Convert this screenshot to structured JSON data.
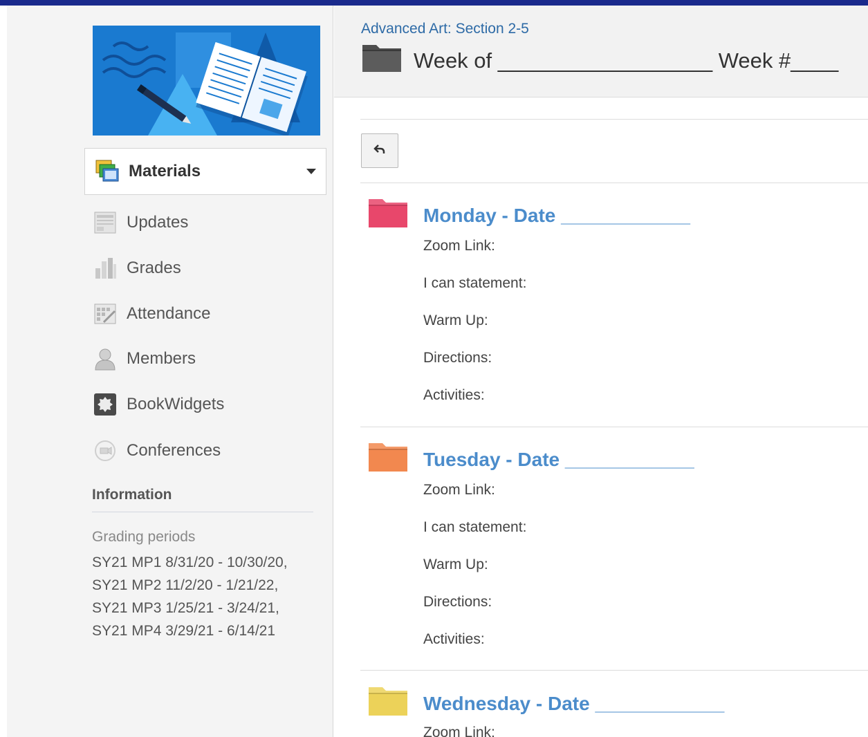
{
  "course": {
    "breadcrumb": "Advanced Art: Section 2-5",
    "title": "Week of __________________ Week #____"
  },
  "sidebar": {
    "materials_label": "Materials",
    "items": [
      {
        "label": "Updates",
        "icon": "updates-icon"
      },
      {
        "label": "Grades",
        "icon": "grades-icon"
      },
      {
        "label": "Attendance",
        "icon": "attendance-icon"
      },
      {
        "label": "Members",
        "icon": "members-icon"
      },
      {
        "label": "BookWidgets",
        "icon": "bookwidgets-icon"
      },
      {
        "label": "Conferences",
        "icon": "conferences-icon"
      }
    ],
    "information_title": "Information",
    "grading_title": "Grading periods",
    "grading_text": "SY21 MP1 8/31/20 - 10/30/20, SY21 MP2 11/2/20 - 1/21/22, SY21 MP3 1/25/21 - 3/24/21, SY21 MP4 3/29/21 - 6/14/21"
  },
  "days": [
    {
      "title": "Monday - Date ____________",
      "folder_color": "#e8476b",
      "fields": [
        "Zoom Link:",
        "I can statement:",
        "Warm Up:",
        "Directions:",
        "Activities:"
      ]
    },
    {
      "title": "Tuesday - Date ____________",
      "folder_color": "#f2884f",
      "fields": [
        "Zoom Link:",
        "I can statement:",
        "Warm Up:",
        "Directions:",
        "Activities:"
      ]
    },
    {
      "title": "Wednesday - Date ____________",
      "folder_color": "#ecd259",
      "fields": [
        "Zoom Link:"
      ]
    }
  ],
  "colors": {
    "topbar": "#1a2a8c",
    "link": "#2d6aa6",
    "day_title": "#4b8ccb",
    "banner": "#1a7ad0"
  }
}
